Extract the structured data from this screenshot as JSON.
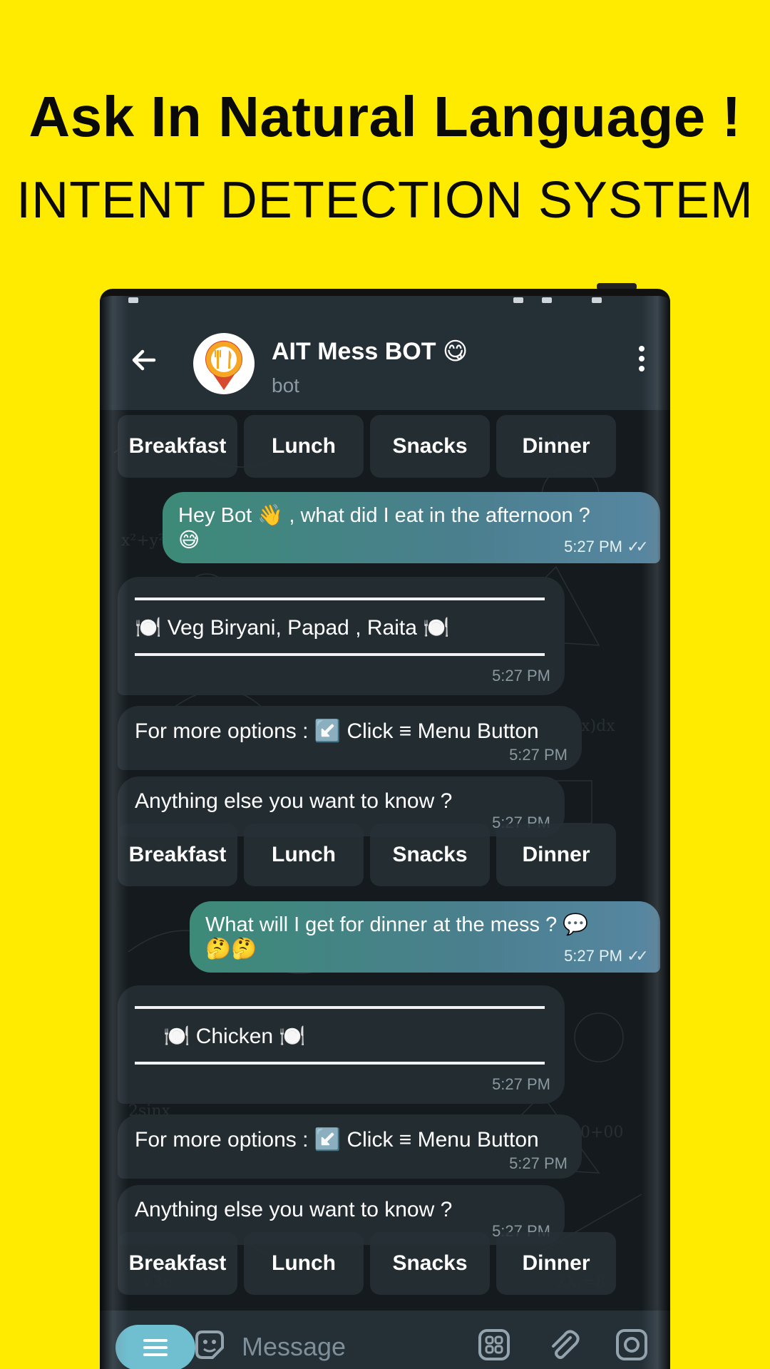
{
  "banner": {
    "headline": "Ask In Natural Language !",
    "subline": "INTENT DETECTION SYSTEM"
  },
  "header": {
    "title": "AIT Mess BOT 😋",
    "subtitle": "bot"
  },
  "keyboard": [
    "Breakfast",
    "Lunch",
    "Snacks",
    "Dinner"
  ],
  "messages": [
    {
      "dir": "out",
      "text1": "Hey Bot 👋 , what did I eat in the afternoon ?",
      "text2": "😅",
      "time": "5:27 PM"
    },
    {
      "dir": "in",
      "text": "🍽️ Veg Biryani, Papad , Raita 🍽️",
      "time": "5:27 PM"
    },
    {
      "dir": "in",
      "text": "For more options : ↙️ Click ≡ Menu Button",
      "time": "5:27 PM"
    },
    {
      "dir": "in",
      "text": "Anything else you want to know ?",
      "time": "5:27 PM"
    },
    {
      "dir": "out",
      "text1": "What will I get for dinner at the mess ? 💬",
      "text2": "🤔🤔",
      "time": "5:27 PM"
    },
    {
      "dir": "in",
      "text": "🍽️ Chicken 🍽️",
      "time": "5:27 PM"
    },
    {
      "dir": "in",
      "text": "For more options : ↙️ Click ≡ Menu Button",
      "time": "5:27 PM"
    },
    {
      "dir": "in",
      "text": "Anything else you want to know ?",
      "time": "5:27 PM"
    }
  ],
  "input": {
    "placeholder": "Message",
    "icons": [
      "menu-icon",
      "sticker-icon",
      "bot-commands-icon",
      "attach-icon",
      "camera-icon"
    ]
  },
  "colors": {
    "background": "#FFEB00",
    "appbar": "#242f36",
    "outgoing_bubble": "#4a7f8e",
    "incoming_bubble": "#222c31"
  }
}
